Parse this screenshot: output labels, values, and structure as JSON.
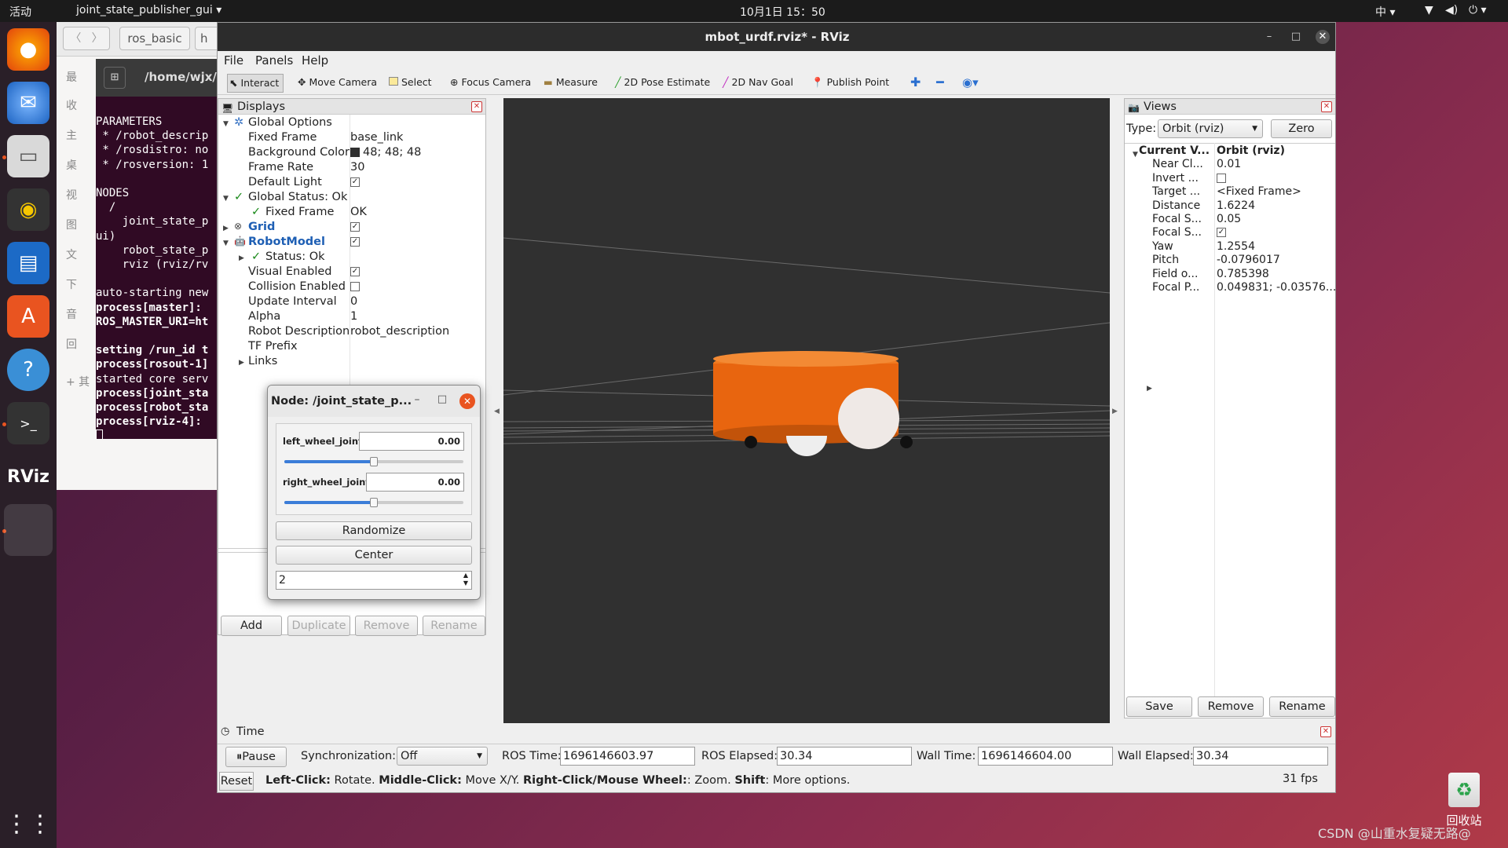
{
  "topbar": {
    "activities": "活动",
    "app_name": "joint_state_publisher_gui",
    "clock": "10月1日  15：50",
    "input_method": "中"
  },
  "dock": {
    "items": [
      "firefox-icon",
      "thunderbird-icon",
      "files-icon",
      "rhythmbox-icon",
      "writer-icon",
      "software-icon",
      "help-icon",
      "terminal-icon",
      "rviz-icon",
      "active-window",
      "apps-grid-icon"
    ]
  },
  "filemgr": {
    "tab1": "ros_basic",
    "tab2": "h",
    "side": [
      "最",
      "收",
      "主",
      "桌",
      "视",
      "图",
      "文",
      "下",
      "音",
      "回",
      "+ 其"
    ]
  },
  "terminal": {
    "title": "/home/wjx/t",
    "lines": [
      {
        "t": "PARAMETERS",
        "b": false
      },
      {
        "t": " * /robot_descrip",
        "b": false
      },
      {
        "t": " * /rosdistro: no",
        "b": false
      },
      {
        "t": " * /rosversion: 1",
        "b": false
      },
      {
        "t": "",
        "b": false
      },
      {
        "t": "NODES",
        "b": false
      },
      {
        "t": "  /",
        "b": false
      },
      {
        "t": "    joint_state_p",
        "b": false
      },
      {
        "t": "ui)",
        "b": false
      },
      {
        "t": "    robot_state_p",
        "b": false
      },
      {
        "t": "    rviz (rviz/rv",
        "b": false
      },
      {
        "t": "",
        "b": false
      },
      {
        "t": "auto-starting new",
        "b": false
      },
      {
        "t": "process[master]:",
        "b": true
      },
      {
        "t": "ROS_MASTER_URI=ht",
        "b": true
      },
      {
        "t": "",
        "b": false
      },
      {
        "t": "setting /run_id t",
        "b": true
      },
      {
        "t": "process[rosout-1]",
        "b": true
      },
      {
        "t": "started core serv",
        "b": false
      },
      {
        "t": "process[joint_sta",
        "b": true
      },
      {
        "t": "process[robot_sta",
        "b": true
      },
      {
        "t": "process[rviz-4]:",
        "b": true
      }
    ]
  },
  "rviz": {
    "title": "mbot_urdf.rviz* - RViz",
    "menu": [
      "File",
      "Panels",
      "Help"
    ],
    "toolbar": [
      {
        "label": "Interact",
        "icon": "cursor-icon"
      },
      {
        "label": "Move Camera",
        "icon": "move-camera-icon"
      },
      {
        "label": "Select",
        "icon": "select-icon"
      },
      {
        "label": "Focus Camera",
        "icon": "focus-camera-icon"
      },
      {
        "label": "Measure",
        "icon": "measure-icon"
      },
      {
        "label": "2D Pose Estimate",
        "icon": "pose-estimate-icon"
      },
      {
        "label": "2D Nav Goal",
        "icon": "nav-goal-icon"
      },
      {
        "label": "Publish Point",
        "icon": "publish-point-icon"
      }
    ],
    "displays": {
      "title": "Displays",
      "global_options": "Global Options",
      "fixed_frame_label": "Fixed Frame",
      "fixed_frame_value": "base_link",
      "bg_color_label": "Background Color",
      "bg_color_value": "48; 48; 48",
      "frame_rate_label": "Frame Rate",
      "frame_rate_value": "30",
      "default_light_label": "Default Light",
      "global_status": "Global Status: Ok",
      "status_fixed_frame": "Fixed Frame",
      "status_fixed_frame_value": "OK",
      "grid": "Grid",
      "robot_model": "RobotModel",
      "status_ok": "Status: Ok",
      "visual_enabled": "Visual Enabled",
      "collision_enabled": "Collision Enabled",
      "update_interval": "Update Interval",
      "update_interval_value": "0",
      "alpha": "Alpha",
      "alpha_value": "1",
      "robot_description": "Robot Description",
      "robot_description_value": "robot_description",
      "tf_prefix": "TF Prefix",
      "links": "Links",
      "buttons": {
        "add": "Add",
        "duplicate": "Duplicate",
        "remove": "Remove",
        "rename": "Rename"
      }
    },
    "views": {
      "title": "Views",
      "type_label": "Type:",
      "type_value": "Orbit (rviz)",
      "zero": "Zero",
      "rows": [
        {
          "k": "Current V...",
          "v": "Orbit (rviz)"
        },
        {
          "k": "Near Cl...",
          "v": "0.01"
        },
        {
          "k": "Invert ...",
          "v": ""
        },
        {
          "k": "Target ...",
          "v": "<Fixed Frame>"
        },
        {
          "k": "Distance",
          "v": "1.6224"
        },
        {
          "k": "Focal S...",
          "v": "0.05"
        },
        {
          "k": "Focal S...",
          "v": ""
        },
        {
          "k": "Yaw",
          "v": "1.2554"
        },
        {
          "k": "Pitch",
          "v": "-0.0796017"
        },
        {
          "k": "Field o...",
          "v": "0.785398"
        },
        {
          "k": "Focal P...",
          "v": "0.049831; -0.03576..."
        }
      ],
      "buttons": {
        "save": "Save",
        "remove": "Remove",
        "rename": "Rename"
      }
    },
    "time": {
      "title": "Time",
      "pause": "Pause",
      "sync_label": "Synchronization:",
      "sync_value": "Off",
      "ros_time_label": "ROS Time:",
      "ros_time": "1696146603.97",
      "ros_elapsed_label": "ROS Elapsed:",
      "ros_elapsed": "30.34",
      "wall_time_label": "Wall Time:",
      "wall_time": "1696146604.00",
      "wall_elapsed_label": "Wall Elapsed:",
      "wall_elapsed": "30.34"
    },
    "status": {
      "reset": "Reset",
      "lc": "Left-Click:",
      "lc_t": " Rotate. ",
      "mc": "Middle-Click:",
      "mc_t": " Move X/Y. ",
      "rc": "Right-Click/Mouse Wheel:",
      "rc_t": ": Zoom. ",
      "sh": "Shift",
      "sh_t": ": More options.",
      "fps": "31 fps"
    }
  },
  "jsp": {
    "title": "Node: /joint_state_p...",
    "left_label": "left_wheel_joint",
    "left_value": "0.00",
    "left_fraction": 0.5,
    "right_label": "right_wheel_joint",
    "right_value": "0.00",
    "right_fraction": 0.5,
    "randomize": "Randomize",
    "center": "Center",
    "spin_value": "2"
  },
  "desktop": {
    "trash": "回收站",
    "watermark": "CSDN @山重水复疑无路@"
  },
  "colors": {
    "robot_body": "#e8650f",
    "viewport_bg": "#303030",
    "terminal_bg": "#300a24"
  }
}
